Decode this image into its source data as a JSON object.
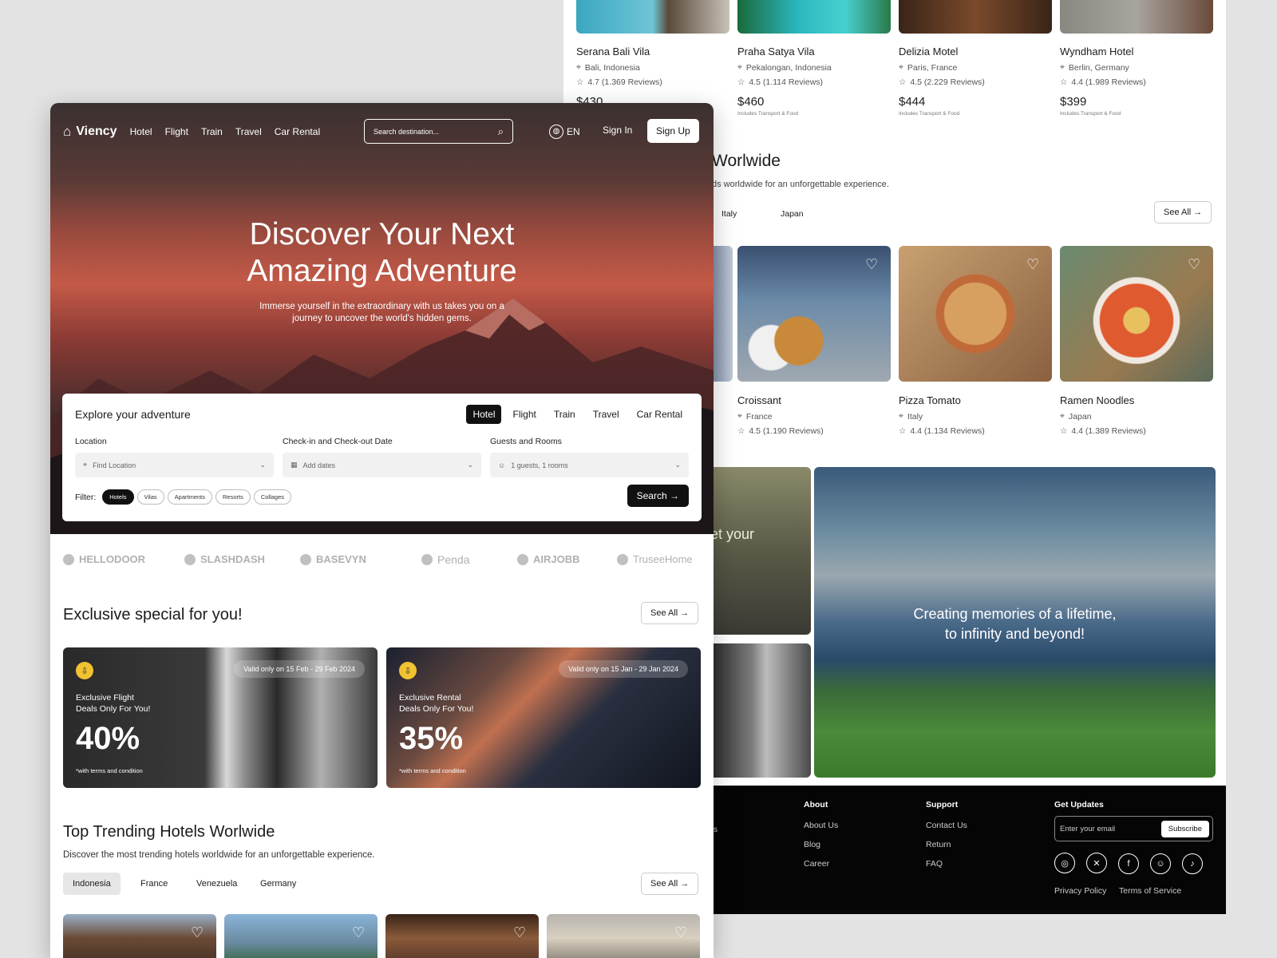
{
  "back": {
    "hotels": [
      {
        "name": "Serana Bali Vila",
        "location": "Bali, Indonesia",
        "rating": "4.7 (1.369 Reviews)",
        "price": "$430",
        "note": ""
      },
      {
        "name": "Praha Satya Vila",
        "location": "Pekalongan, Indonesia",
        "rating": "4.5 (1.114 Reviews)",
        "price": "$460",
        "note": "Includes Transport & Food"
      },
      {
        "name": "Delizia Motel",
        "location": "Paris, France",
        "rating": "4.5 (2.229 Reviews)",
        "price": "$444",
        "note": "Includes Transport & Food"
      },
      {
        "name": "Wyndham Hotel",
        "location": "Berlin, Germany",
        "rating": "4.4 (1.989 Reviews)",
        "price": "$399",
        "note": "Includes Transport & Food"
      }
    ],
    "food_title": "Worlwide",
    "food_sub": "ds worldwide for an unforgettable experience.",
    "food_tabs": [
      "Italy",
      "Japan"
    ],
    "see_all": "See All",
    "foods": [
      {
        "name": "Croissant",
        "location": "France",
        "rating": "4.5 (1.190 Reviews)"
      },
      {
        "name": "Pizza Tomato",
        "location": "Italy",
        "rating": "4.4 (1.134 Reviews)"
      },
      {
        "name": "Ramen Noodles",
        "location": "Japan",
        "rating": "4.4 (1.389 Reviews)"
      }
    ],
    "partial_text": "et your",
    "banner_line1": "Creating memories of a lifetime,",
    "banner_line2": "to infinity and beyond!",
    "footer": {
      "about_h": "About",
      "about": [
        "About Us",
        "Blog",
        "Career"
      ],
      "support_h": "Support",
      "support": [
        "Contact Us",
        "Return",
        "FAQ"
      ],
      "updates_h": "Get Updates",
      "email_ph": "Enter your email",
      "subscribe": "Subscribe",
      "privacy": "Privacy Policy",
      "terms": "Terms of Service",
      "partial": "s"
    }
  },
  "front": {
    "brand": "Viency",
    "nav": [
      "Hotel",
      "Flight",
      "Train",
      "Travel",
      "Car Rental"
    ],
    "search_ph": "Search destination...",
    "lang": "EN",
    "signin": "Sign In",
    "signup": "Sign Up",
    "hero_title1": "Discover Your Next",
    "hero_title2": "Amazing Adventure",
    "hero_sub1": "Immerse yourself in the extraordinary with us takes you on a",
    "hero_sub2": "journey to uncover the world's hidden gems.",
    "explore_title": "Explore your adventure",
    "tabs": [
      "Hotel",
      "Flight",
      "Train",
      "Travel",
      "Car Rental"
    ],
    "location_label": "Location",
    "location_ph": "Find Location",
    "date_label": "Check-in and Check-out Date",
    "date_ph": "Add dates",
    "guest_label": "Guests and Rooms",
    "guest_val": "1 guests, 1 rooms",
    "filter_label": "Filter:",
    "filters": [
      "Hotels",
      "Vilas",
      "Apartments",
      "Resorts",
      "Collages"
    ],
    "search_btn": "Search",
    "logos": [
      "HELLODOOR",
      "SLASHDASH",
      "BASEVYN",
      "Penda",
      "AIRJOBB",
      "TruseeHome"
    ],
    "exclusive_title": "Exclusive special for you!",
    "see_all": "See All",
    "deals": [
      {
        "valid": "Valid only on 15 Feb - 29 Feb 2024",
        "line1": "Exclusive Flight",
        "line2": "Deals Only For You!",
        "pct": "40%",
        "terms": "*with terms and condition"
      },
      {
        "valid": "Valid only on 15 Jan - 29 Jan 2024",
        "line1": "Exclusive Rental",
        "line2": "Deals Only For You!",
        "pct": "35%",
        "terms": "*with terms and condition"
      }
    ],
    "trending_title": "Top Trending Hotels Worlwide",
    "trending_sub": "Discover the most trending hotels worldwide for an unforgettable experience.",
    "countries": [
      "Indonesia",
      "France",
      "Venezuela",
      "Germany"
    ]
  }
}
